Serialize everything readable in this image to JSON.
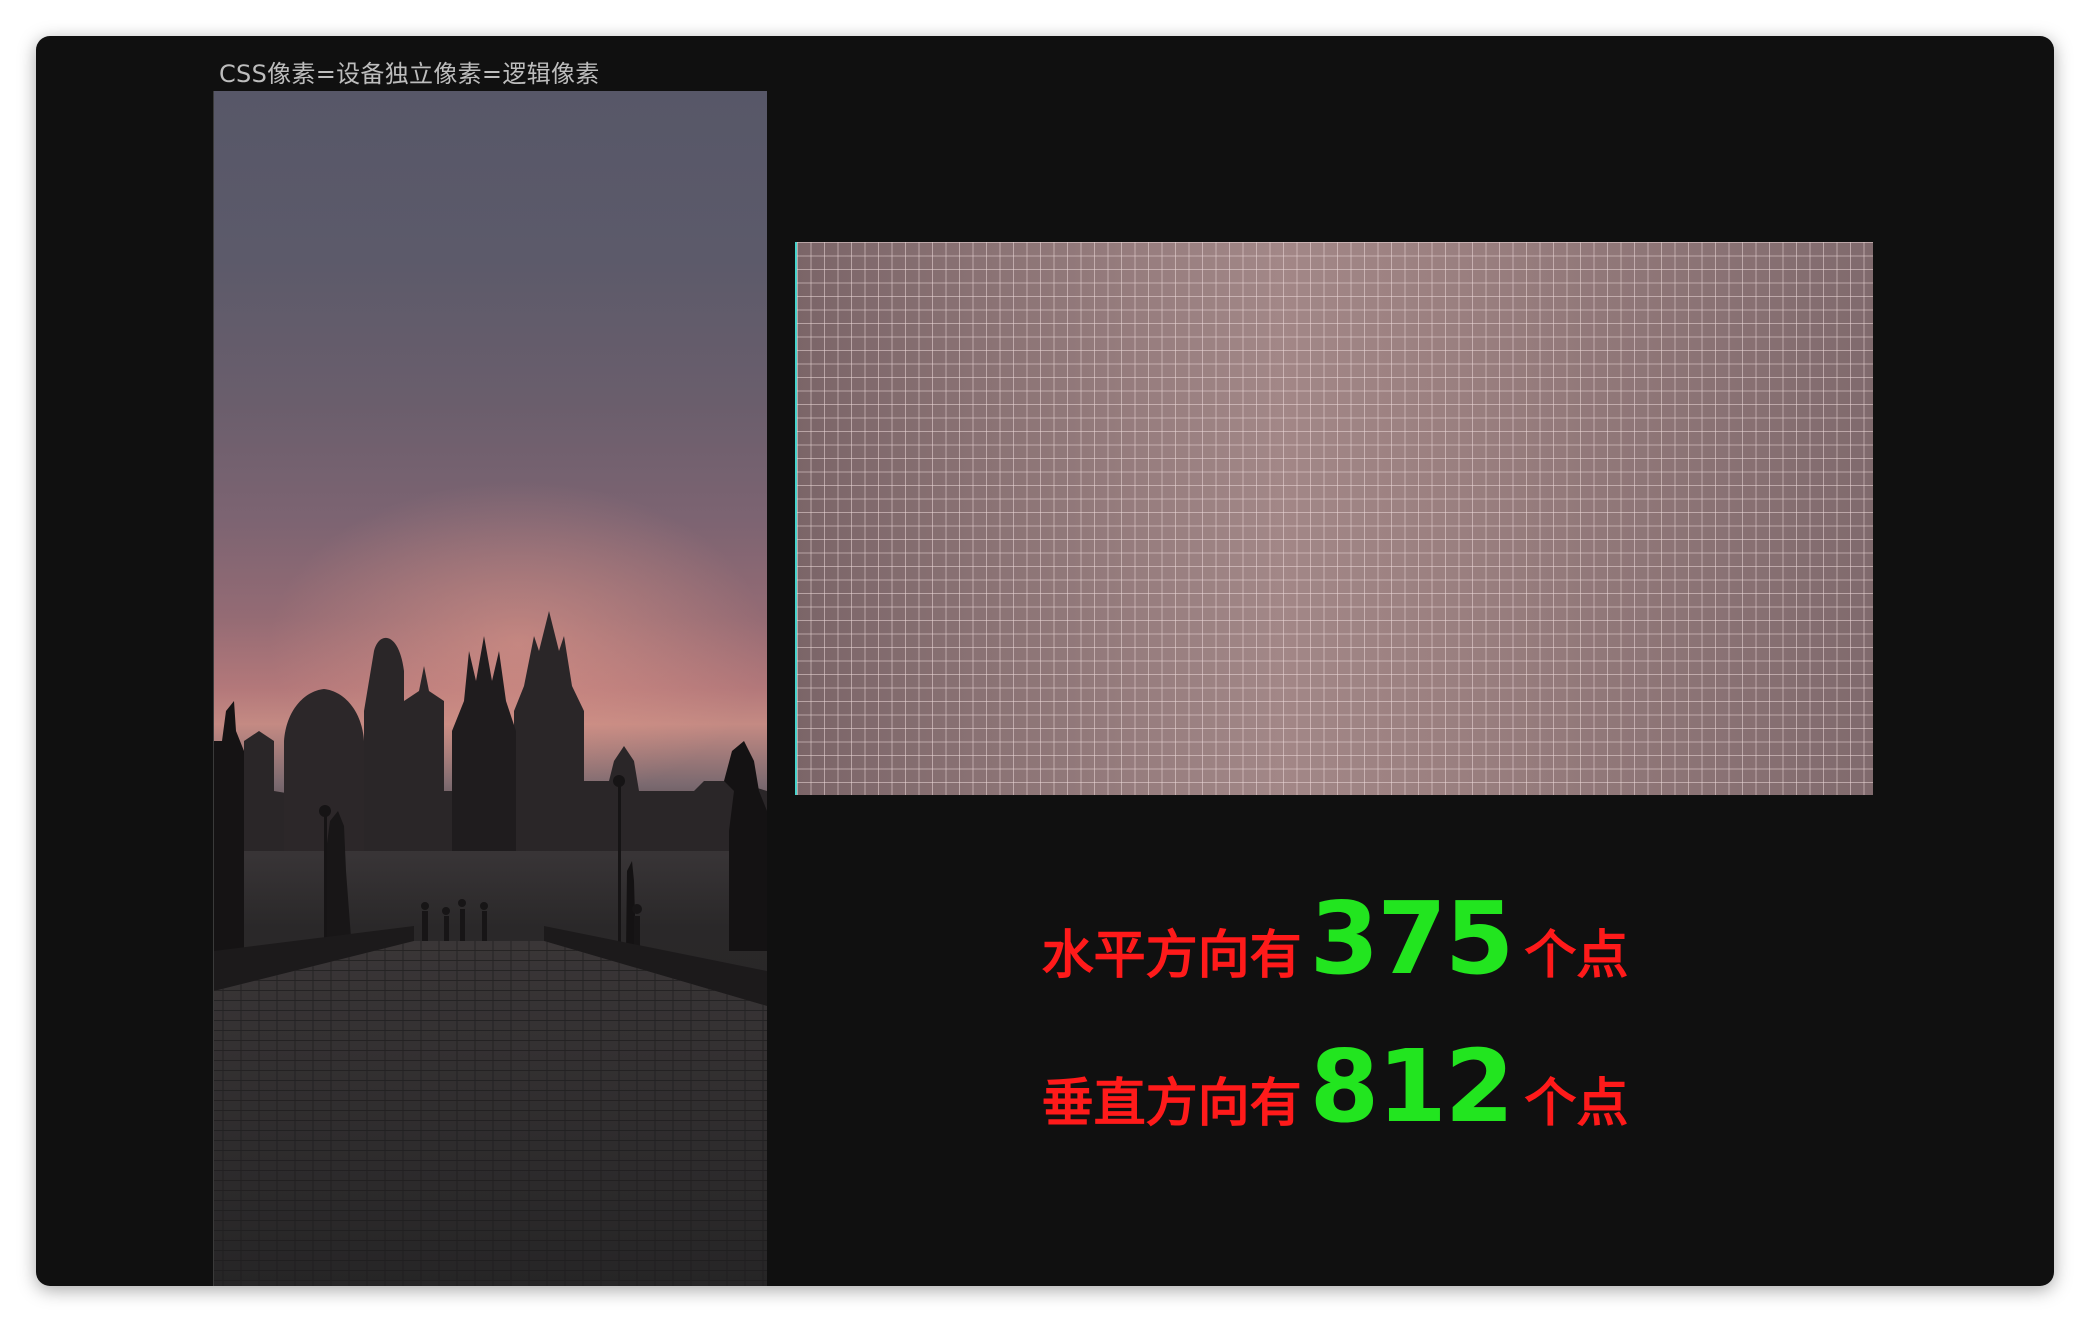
{
  "caption": "CSS像素=设备独立像素=逻辑像素",
  "horizontal": {
    "prefix": "水平方向有",
    "value": "375",
    "suffix": "个点"
  },
  "vertical": {
    "prefix": "垂直方向有",
    "value": "812",
    "suffix": "个点"
  },
  "colors": {
    "background": "#101010",
    "label": "#ff1a1a",
    "number": "#22e51f",
    "grid_edge": "#48d3cc"
  }
}
